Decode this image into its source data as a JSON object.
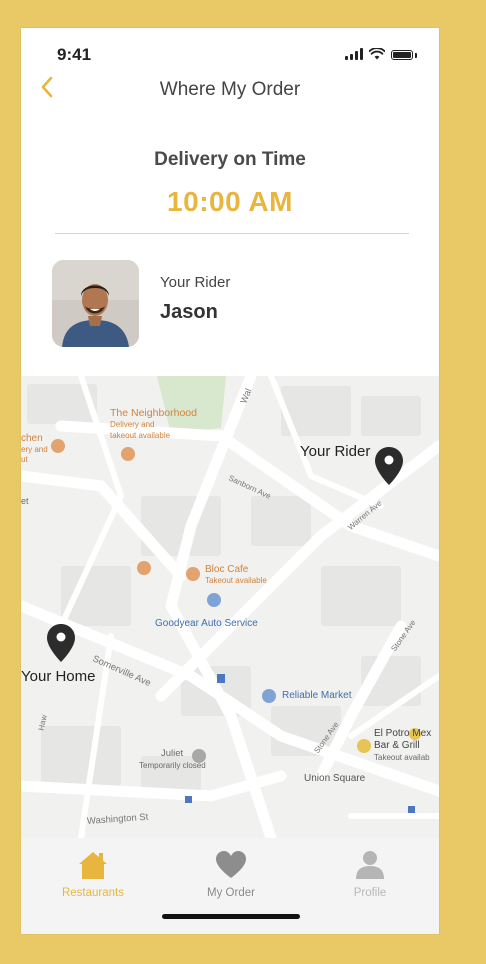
{
  "status": {
    "time": "9:41"
  },
  "header": {
    "title": "Where My Order"
  },
  "delivery": {
    "label": "Delivery on Time",
    "time": "10:00 AM"
  },
  "rider": {
    "label": "Your Rider",
    "name": "Jason"
  },
  "map": {
    "pins": {
      "rider_label": "Your Rider",
      "home_label": "Your Home"
    },
    "places": {
      "neighborhood_name": "The Neighborhood",
      "neighborhood_sub1": "Delivery and",
      "neighborhood_sub2": "takeout available",
      "kitchen_name": "chen",
      "kitchen_sub1": "ery and",
      "kitchen_sub2": "ut",
      "edge_text": "et",
      "bloc_name": "Bloc Cafe",
      "bloc_sub": "Takeout available",
      "goodyear": "Goodyear Auto Service",
      "reliable": "Reliable Market",
      "juliet_name": "Juliet",
      "juliet_sub": "Temporarily closed",
      "elpotro_name": "El Potro Mex",
      "elpotro_name2": "Bar & Grill",
      "elpotro_sub": "Takeout availab",
      "union": "Union Square"
    },
    "streets": {
      "walnut": "Wal",
      "sanborn": "Sanborn Ave",
      "warren": "Warren Ave",
      "somerville": "Somerville Ave",
      "stone": "Stone Ave",
      "stone2": "Stone Ave",
      "washington": "Washington St",
      "hawk": "Haw"
    }
  },
  "tabs": [
    {
      "label": "Restaurants",
      "icon": "house-icon",
      "active": true
    },
    {
      "label": "My Order",
      "icon": "heart-icon",
      "active": false
    },
    {
      "label": "Profile",
      "icon": "person-icon",
      "active": false
    }
  ],
  "colors": {
    "accent": "#E8B63E",
    "background": "#E9C966"
  }
}
